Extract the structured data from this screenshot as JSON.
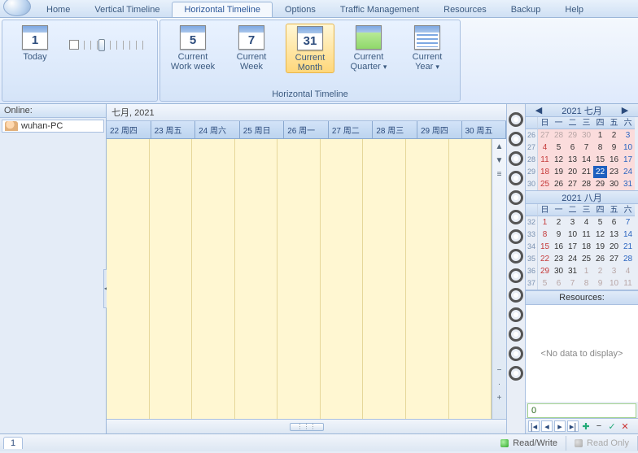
{
  "tabs": {
    "items": [
      "Home",
      "Vertical Timeline",
      "Horizontal Timeline",
      "Options",
      "Traffic Management",
      "Resources",
      "Backup",
      "Help"
    ],
    "active": 2
  },
  "ribbon": {
    "group1": {
      "today": "Today",
      "caption": ""
    },
    "group2": {
      "caption": "Horizontal Timeline",
      "items": [
        {
          "num": "5",
          "label": "Current\nWork week"
        },
        {
          "num": "7",
          "label": "Current\nWeek"
        },
        {
          "num": "31",
          "label": "Current\nMonth"
        },
        {
          "num": "",
          "label": "Current\nQuarter",
          "green": true,
          "drop": true
        },
        {
          "num": "",
          "label": "Current\nYear",
          "rows": true,
          "drop": true
        }
      ],
      "selected": 2
    }
  },
  "online": {
    "header": "Online:",
    "user": "wuhan-PC"
  },
  "timeline": {
    "title": "七月, 2021",
    "days": [
      "22 周四",
      "23 周五",
      "24 周六",
      "25 周日",
      "26 周一",
      "27 周二",
      "28 周三",
      "29 周四",
      "30 周五"
    ]
  },
  "calendars": [
    {
      "title": "2021 七月",
      "wk_hd": [
        "",
        "日",
        "一",
        "二",
        "三",
        "四",
        "五",
        "六"
      ],
      "pink": true,
      "rows": [
        [
          "26",
          "27",
          "28",
          "29",
          "30",
          "1",
          "2",
          "3"
        ],
        [
          "27",
          "4",
          "5",
          "6",
          "7",
          "8",
          "9",
          "10"
        ],
        [
          "28",
          "11",
          "12",
          "13",
          "14",
          "15",
          "16",
          "17"
        ],
        [
          "29",
          "18",
          "19",
          "20",
          "21",
          "22",
          "23",
          "24"
        ],
        [
          "30",
          "25",
          "26",
          "27",
          "28",
          "29",
          "30",
          "31"
        ]
      ],
      "today": [
        3,
        5
      ],
      "dim_first": [
        0,
        1,
        2,
        3
      ]
    },
    {
      "title": "2021 八月",
      "wk_hd": [
        "",
        "日",
        "一",
        "二",
        "三",
        "四",
        "五",
        "六"
      ],
      "pink": false,
      "rows": [
        [
          "32",
          "1",
          "2",
          "3",
          "4",
          "5",
          "6",
          "7"
        ],
        [
          "33",
          "8",
          "9",
          "10",
          "11",
          "12",
          "13",
          "14"
        ],
        [
          "34",
          "15",
          "16",
          "17",
          "18",
          "19",
          "20",
          "21"
        ],
        [
          "35",
          "22",
          "23",
          "24",
          "25",
          "26",
          "27",
          "28"
        ],
        [
          "36",
          "29",
          "30",
          "31",
          "1",
          "2",
          "3",
          "4"
        ],
        [
          "37",
          "5",
          "6",
          "7",
          "8",
          "9",
          "10",
          "11"
        ]
      ],
      "dim_last": [
        [
          4,
          4,
          5,
          6,
          7
        ],
        [
          5,
          1,
          2,
          3,
          4,
          5,
          6,
          7
        ]
      ]
    }
  ],
  "resources": {
    "header": "Resources:",
    "empty": "<No data to display>"
  },
  "spin": {
    "value": "0"
  },
  "status": {
    "tab": "1",
    "rw": "Read/Write",
    "ro": "Read Only"
  }
}
